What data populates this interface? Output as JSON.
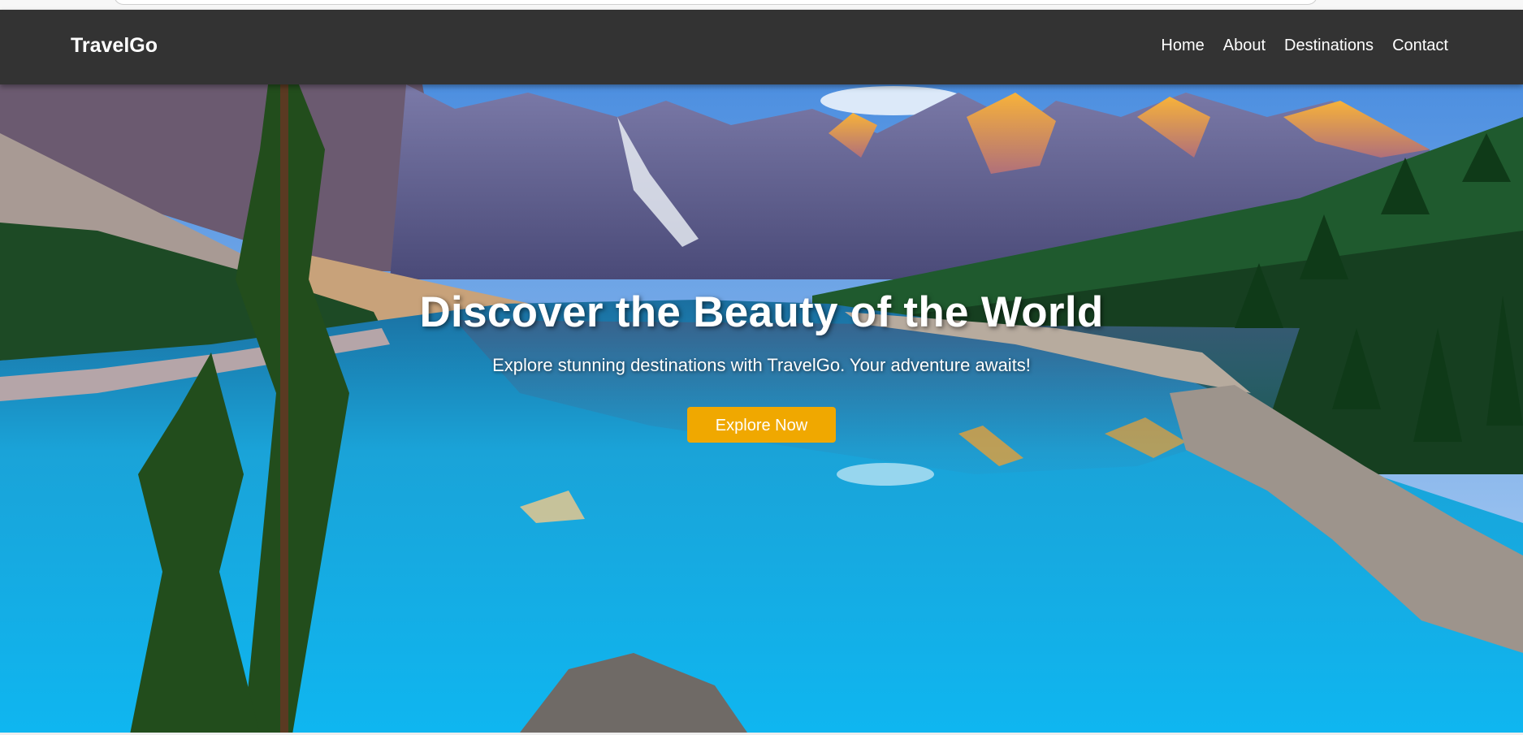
{
  "navbar": {
    "brand": "TravelGo",
    "links": [
      {
        "label": "Home"
      },
      {
        "label": "About"
      },
      {
        "label": "Destinations"
      },
      {
        "label": "Contact"
      }
    ],
    "background_color": "#333333"
  },
  "hero": {
    "title": "Discover the Beauty of the World",
    "subtitle": "Explore stunning destinations with TravelGo. Your adventure awaits!",
    "cta_label": "Explore Now",
    "cta_color": "#f0a800",
    "background_image": "mountain-lake-icon"
  }
}
